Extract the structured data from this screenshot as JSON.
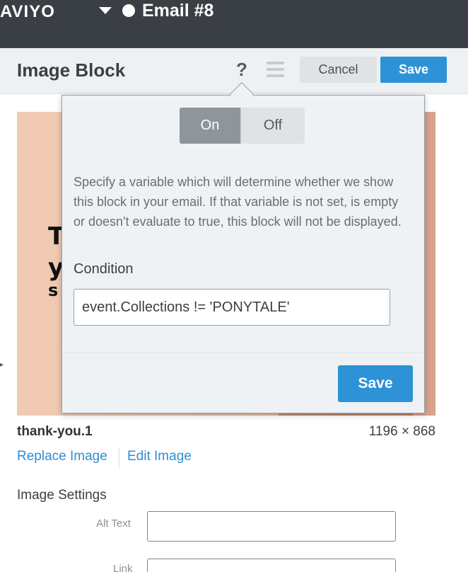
{
  "topbar": {
    "brand": "AVIYO",
    "email_title": "Email #8"
  },
  "header": {
    "title": "Image Block",
    "help_glyph": "?",
    "cancel_label": "Cancel",
    "save_label": "Save"
  },
  "preview": {
    "line1": "T",
    "line2": "y",
    "line3": "s"
  },
  "image": {
    "name": "thank-you.1",
    "dimensions": "1196 × 868",
    "replace_label": "Replace Image",
    "edit_label": "Edit Image"
  },
  "settings": {
    "title": "Image Settings",
    "alt_text_label": "Alt Text",
    "alt_text_value": "",
    "link_label": "Link",
    "link_value": ""
  },
  "popover": {
    "toggle_on": "On",
    "toggle_off": "Off",
    "toggle_selected": "On",
    "description": "Specify a variable which will determine whether we show this block in your email. If that variable is not set, is empty or doesn't evaluate to true, this block will not be displayed.",
    "condition_label": "Condition",
    "condition_value": "event.Collections != 'PONYTALE'",
    "save_label": "Save"
  },
  "icons": {
    "caret": "caret-down-icon",
    "status": "circle-icon",
    "help": "question-icon",
    "menu": "hamburger-icon"
  },
  "colors": {
    "primary": "#2d93d6",
    "topbar": "#3a3f45",
    "toggle_active": "#8e959b"
  }
}
